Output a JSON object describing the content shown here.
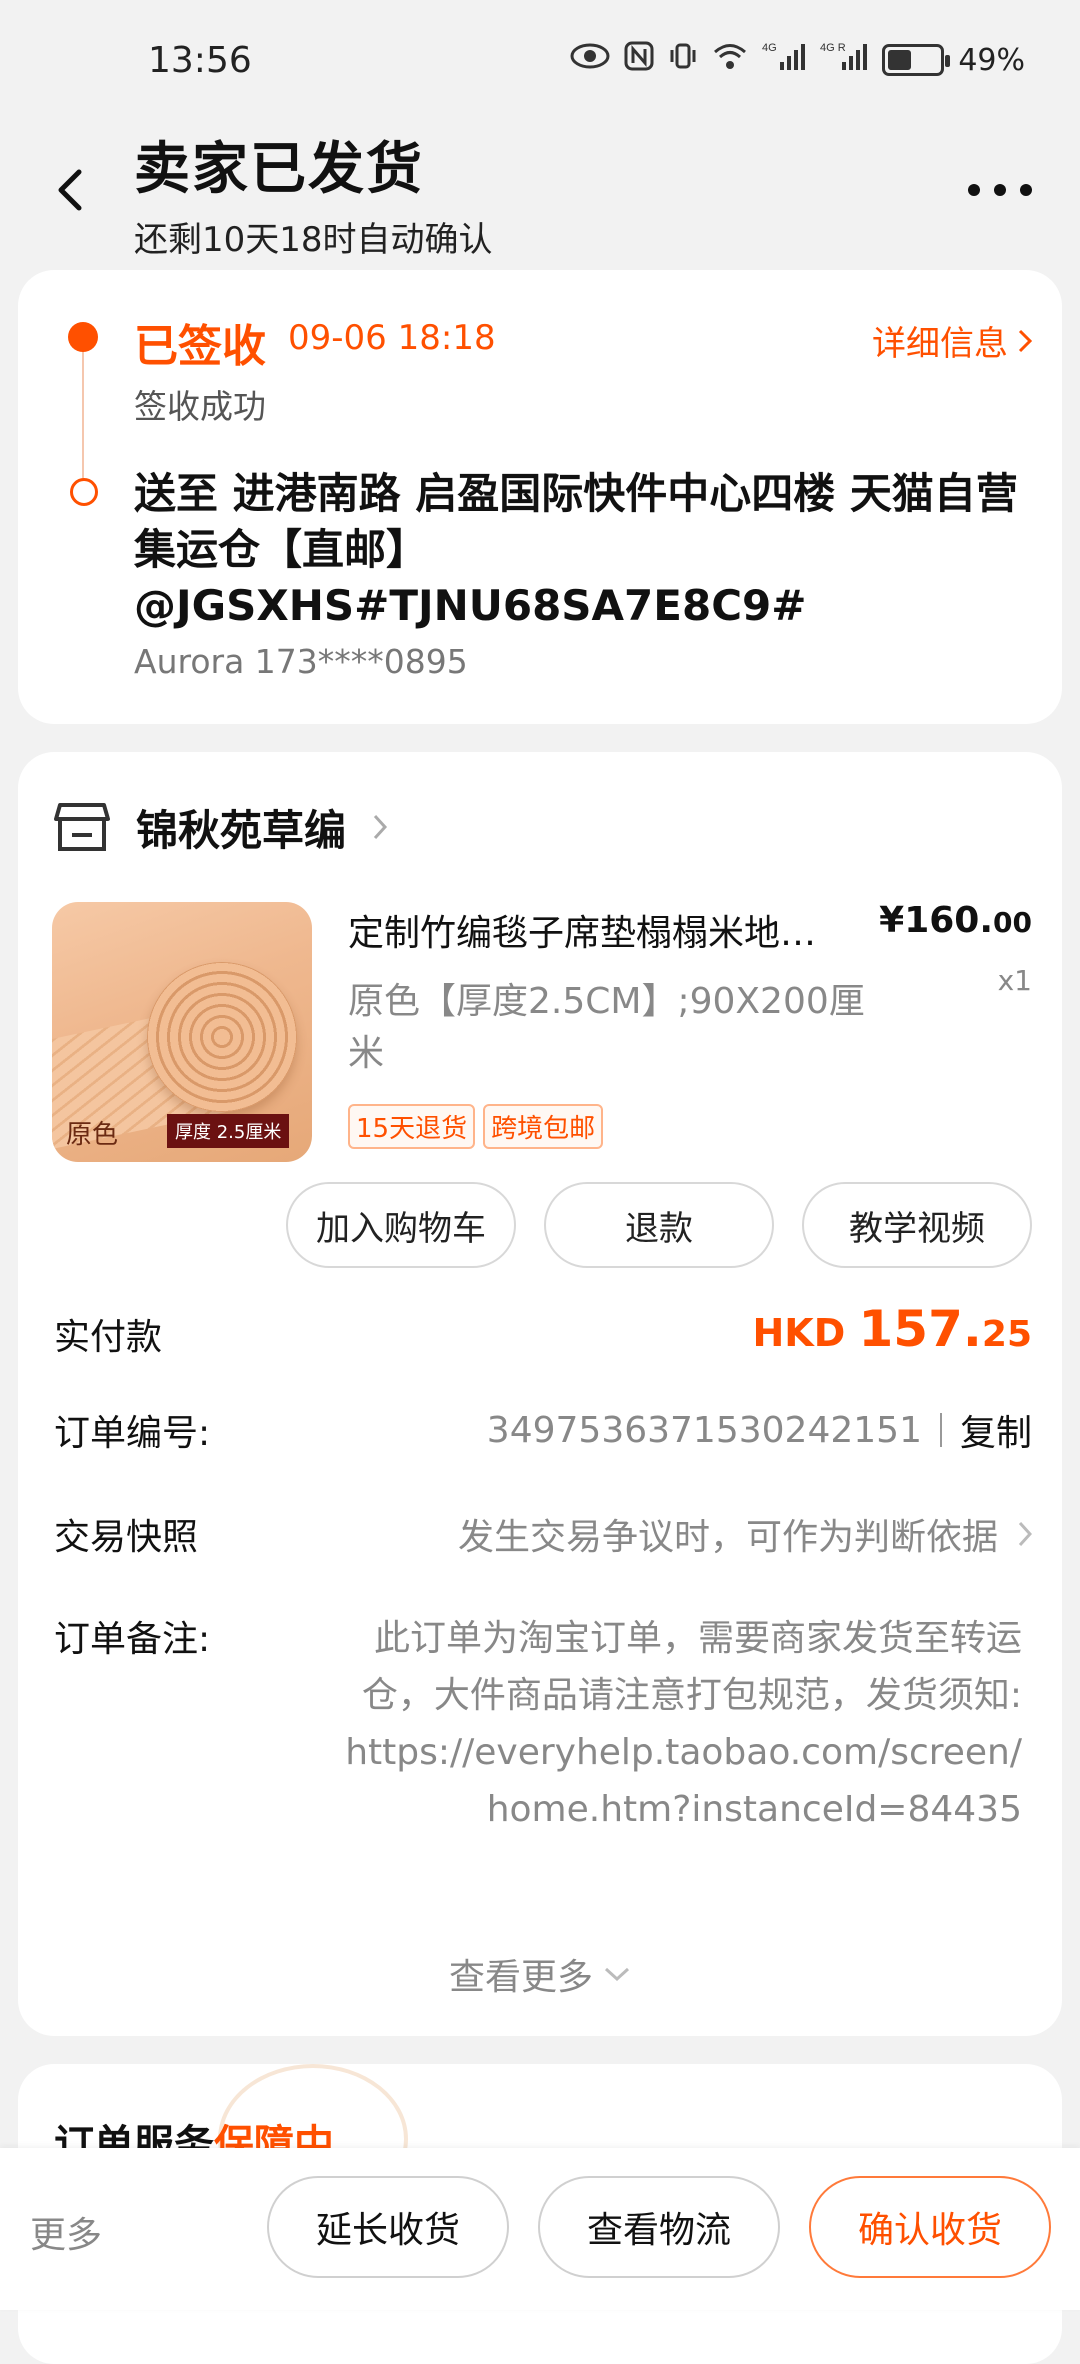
{
  "status_bar": {
    "time": "13:56",
    "network_1": "4G",
    "network_2": "4G R",
    "battery": "49%",
    "battery_level": 0.49,
    "icons": [
      "eye-icon",
      "nfc-icon",
      "vibrate-icon",
      "wifi-icon",
      "signal-icon",
      "signal-icon",
      "battery-icon"
    ]
  },
  "header": {
    "title": "卖家已发货",
    "subtitle": "还剩10天18时自动确认"
  },
  "logistics": {
    "status": "已签收",
    "time": "09-06 18:18",
    "detail_link": "详细信息",
    "sign_text": "签收成功",
    "address": "送至 进港南路 启盈国际快件中心四楼 天猫自营集运仓【直邮】@JGSXHS#TJNU68SA7E8C9#",
    "receiver": "Aurora 173****0895"
  },
  "order": {
    "shop_name": "锦秋苑草编",
    "product": {
      "title": "定制竹编毯子席垫榻榻米地…",
      "price_int": "¥160.",
      "price_dec": "00",
      "qty": "x1",
      "spec": "原色【厚度2.5CM】;90X200厘米",
      "thumb_caption_1": "原色",
      "thumb_caption_2": "厚度 2.5厘米",
      "tags": [
        "15天退货",
        "跨境包邮"
      ]
    },
    "actions": [
      "加入购物车",
      "退款",
      "教学视频"
    ],
    "paid_label": "实付款",
    "paid_currency": "HKD ",
    "paid_int": "157.",
    "paid_dec": "25",
    "order_no_label": "订单编号:",
    "order_no": "3497536371530242151",
    "copy_label": "复制",
    "snapshot_label": "交易快照",
    "snapshot_value": "发生交易争议时，可作为判断依据",
    "remark_label": "订单备注:",
    "remark_value": "此订单为淘宝订单，需要商家发货至转运仓，大件商品请注意打包规范，发货须知: https://everyhelp.taobao.com/screen/home.htm?instanceId=84435",
    "see_more": "查看更多"
  },
  "service": {
    "title_1": "订单服务",
    "title_2": "保障中"
  },
  "bottom_bar": {
    "more": "更多",
    "extend": "延长收货",
    "logistics": "查看物流",
    "confirm": "确认收货"
  },
  "colors": {
    "accent": "#ff5000",
    "background": "#f2f2f2"
  }
}
